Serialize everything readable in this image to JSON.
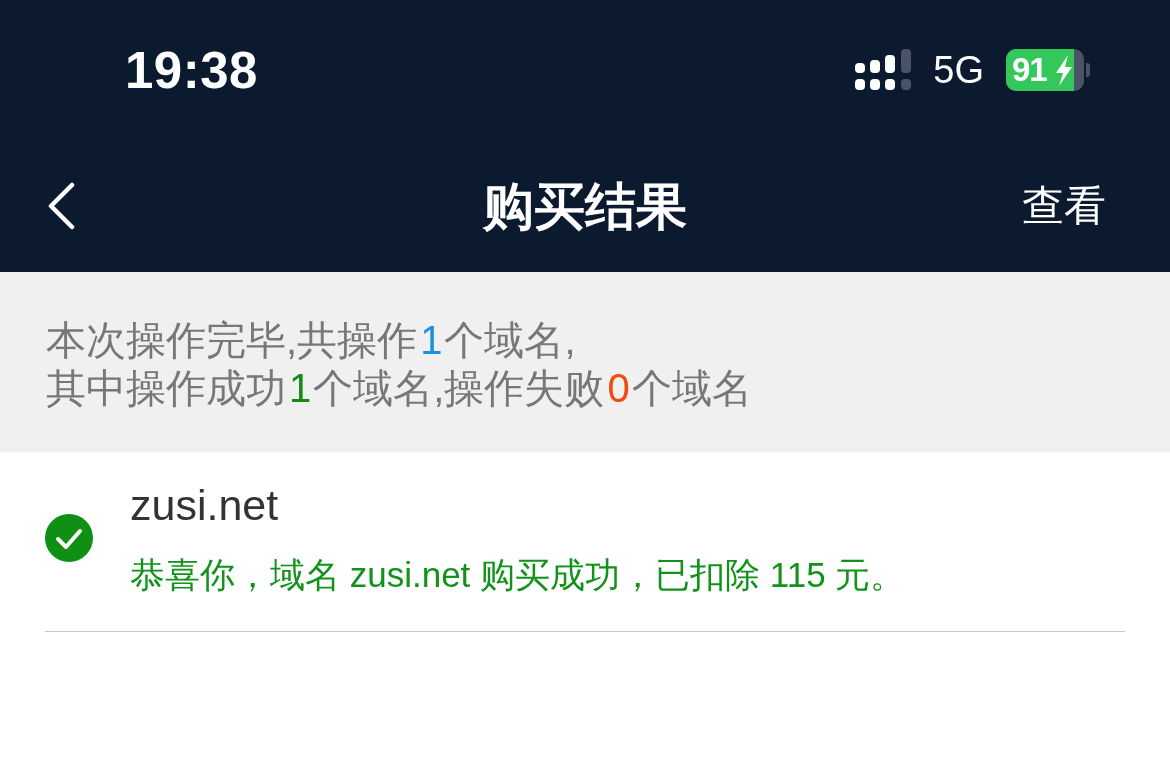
{
  "status_bar": {
    "time": "19:38",
    "network": "5G",
    "battery_percent": "91"
  },
  "nav_bar": {
    "title": "购买结果",
    "action": "查看"
  },
  "summary": {
    "lines": [
      {
        "segments": [
          {
            "kind": "text",
            "text": "本次操作完毕,共操作"
          },
          {
            "kind": "total",
            "text": "1"
          },
          {
            "kind": "text",
            "text": "个域名,"
          }
        ]
      },
      {
        "segments": [
          {
            "kind": "text",
            "text": "其中操作成功"
          },
          {
            "kind": "success",
            "text": "1"
          },
          {
            "kind": "text",
            "text": "个域名,操作失败"
          },
          {
            "kind": "failed",
            "text": "0"
          },
          {
            "kind": "text",
            "text": "个域名"
          }
        ]
      }
    ]
  },
  "results": [
    {
      "success": true,
      "domain": "zusi.net",
      "message": "恭喜你，域名 zusi.net 购买成功，已扣除 115 元。"
    }
  ]
}
